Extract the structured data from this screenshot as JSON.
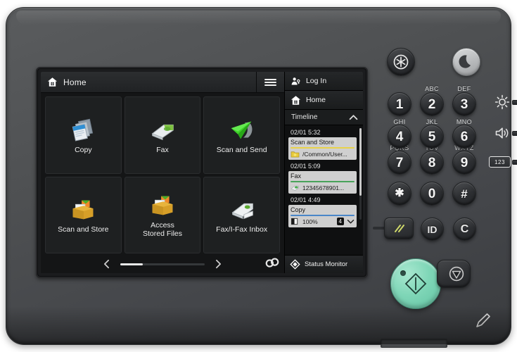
{
  "screen": {
    "top_bar": {
      "title": "Home",
      "home_icon": "home-house-icon",
      "menu_icon": "hamburger-icon"
    },
    "tiles": [
      {
        "label": "Copy",
        "icon": "copy-documents-icon"
      },
      {
        "label": "Fax",
        "icon": "fax-machine-icon"
      },
      {
        "label": "Scan and Send",
        "icon": "paper-plane-icon"
      },
      {
        "label": "Scan and Store",
        "icon": "scan-store-box-icon"
      },
      {
        "label": "Access\nStored Files",
        "line1": "Access",
        "line2": "Stored Files",
        "icon": "stored-files-box-icon"
      },
      {
        "label": "Fax/I-Fax Inbox",
        "icon": "fax-inbox-icon"
      }
    ],
    "pager": {
      "prev_icon": "chevron-left-icon",
      "next_icon": "chevron-right-icon",
      "link_icon": "link-chain-icon"
    },
    "sidebar": {
      "login": {
        "label": "Log In",
        "icon": "person-key-icon"
      },
      "home": {
        "label": "Home",
        "icon": "home-house-icon"
      },
      "timeline": {
        "title": "Timeline",
        "collapse_icon": "chevron-up-icon",
        "entries": [
          {
            "time": "02/01 5:32",
            "title": "Scan and Store",
            "detail": "/Common/User...",
            "accent_color": "#e8d24a",
            "icon": "yellow-folder-icon"
          },
          {
            "time": "02/01 5:09",
            "title": "Fax",
            "detail": "12345678901...",
            "accent_color": "#49a35a",
            "icon": "green-fax-icon"
          },
          {
            "time": "02/01 4:49",
            "title": "Copy",
            "detail": "100%",
            "badge": "4",
            "accent_color": "#4a86c8",
            "icon": "contrast-square-icon",
            "expand_icon": "chevron-down-icon"
          }
        ]
      },
      "status_monitor": {
        "label": "Status Monitor",
        "icon": "status-diamond-icon"
      }
    }
  },
  "controls": {
    "power_saver": {
      "name": "settings-asterisk-button",
      "icon": "asterisk-circle-icon"
    },
    "energy_saver": {
      "name": "energy-saver-button",
      "icon": "crescent-moon-icon"
    },
    "keypad": [
      {
        "digit": "1",
        "letters": ""
      },
      {
        "digit": "2",
        "letters": "ABC"
      },
      {
        "digit": "3",
        "letters": "DEF"
      },
      {
        "digit": "4",
        "letters": "GHI"
      },
      {
        "digit": "5",
        "letters": "JKL"
      },
      {
        "digit": "6",
        "letters": "MNO"
      },
      {
        "digit": "7",
        "letters": "PQRS"
      },
      {
        "digit": "8",
        "letters": "TUV"
      },
      {
        "digit": "9",
        "letters": "WXYZ"
      },
      {
        "digit": "✱",
        "letters": ""
      },
      {
        "digit": "0",
        "letters": ""
      },
      {
        "digit": "#",
        "letters": ""
      }
    ],
    "reset": {
      "label": "",
      "icon": "reset-slashes-icon"
    },
    "id": {
      "label": "ID"
    },
    "clear": {
      "label": "C"
    },
    "start": {
      "icon": "start-diamond-icon"
    },
    "stop": {
      "icon": "stop-octagon-icon"
    },
    "brightness": {
      "icon": "brightness-sun-icon"
    },
    "volume": {
      "icon": "volume-speaker-icon"
    },
    "counter": {
      "label": "123",
      "icon": "counter-check-icon"
    },
    "stylus": {
      "icon": "stylus-pen-icon"
    }
  },
  "accent_colors": {
    "start_green": "#7fd6b7",
    "body_gray": "#4e5052",
    "screen_black": "#141516"
  }
}
